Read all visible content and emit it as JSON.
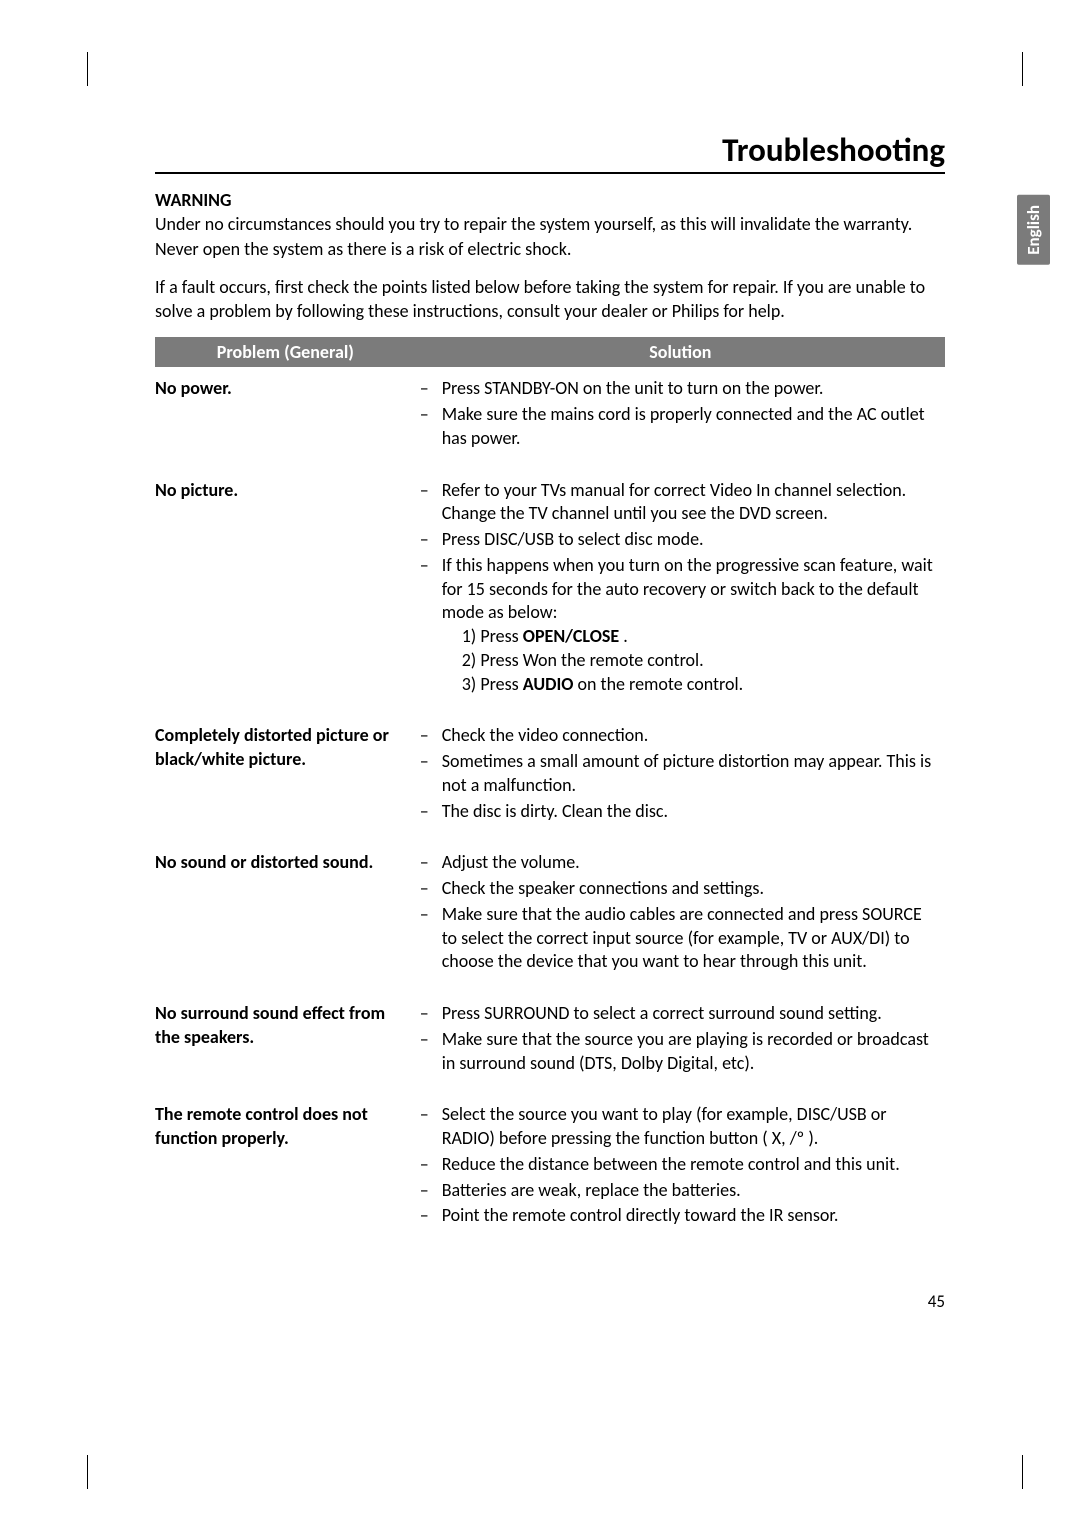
{
  "title": "Troubleshooting",
  "language_tab": "English",
  "page_number": "45",
  "warning": {
    "heading": "WARNING",
    "p1": "Under no circumstances should you try to repair the system yourself, as this will invalidate the warranty. Never open the system as there is a risk of electric shock.",
    "p2": "If a fault occurs, first check the points listed below before taking the system for repair. If you are unable to solve a problem by following these instructions, consult your dealer or Philips for help."
  },
  "table": {
    "header_problem": "Problem (General)",
    "header_solution": "Solution",
    "rows": [
      {
        "problem": "No power.",
        "solutions": [
          "Press STANDBY-ON on the unit to turn on the power.",
          "Make sure the mains cord is properly connected and the AC outlet has power."
        ]
      },
      {
        "problem": "No picture.",
        "solutions": [
          "Refer to your TVs manual for correct Video In channel selection. Change the TV channel until you see the DVD screen.",
          "Press DISC/USB to select disc mode.",
          "If this happens when you turn on the progressive scan feature, wait for 15 seconds for the auto recovery or switch back to the default mode as below:"
        ],
        "nested": [
          {
            "pre": "1)  Press ",
            "bold": "OPEN/CLOSE",
            "post": "    ."
          },
          {
            "pre": "2)  Press  Won the remote control.",
            "bold": "",
            "post": ""
          },
          {
            "pre": "3)  Press ",
            "bold": "AUDIO",
            "post": " on the remote control."
          }
        ]
      },
      {
        "problem": "Completely distorted picture or black/white picture.",
        "solutions": [
          "Check the video connection.",
          "Sometimes a small amount of picture distortion may appear. This is not a malfunction.",
          "The disc is dirty. Clean the disc."
        ]
      },
      {
        "problem": "No sound or distorted sound.",
        "solutions": [
          "Adjust the volume.",
          "Check the speaker connections and settings.",
          "Make sure that the audio cables are connected and press SOURCE to select the correct input source (for example, TV or AUX/DI) to choose the device that you want to hear through this unit."
        ]
      },
      {
        "problem": "No surround sound effect from the speakers.",
        "solutions": [
          "Press SURROUND to select a correct surround sound setting.",
          "Make sure that the source you are playing is recorded or broadcast in surround sound (DTS, Dolby Digital, etc)."
        ]
      },
      {
        "problem": "The remote control does not function properly.",
        "solutions": [
          "Select the source you want to play (for example, DISC/USB or RADIO) before pressing the function button ( X,    /º  ).",
          "Reduce the distance between the remote control and this unit.",
          "Batteries are weak, replace the batteries.",
          "Point the remote control directly toward the IR sensor."
        ]
      }
    ]
  }
}
